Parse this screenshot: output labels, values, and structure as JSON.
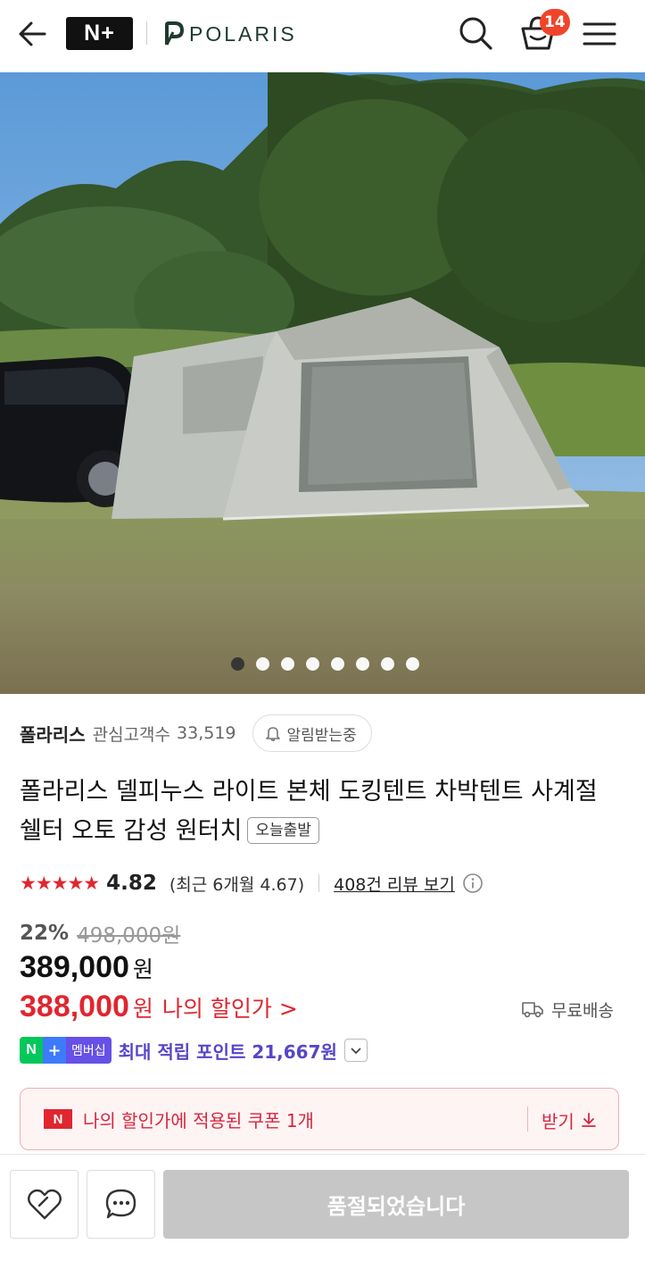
{
  "header": {
    "brand_badge": "N+",
    "brand_name": "POLARIS",
    "cart_count": "14"
  },
  "gallery": {
    "total_images": 8,
    "active_index": 0
  },
  "store": {
    "name": "폴라리스",
    "fav_label": "관심고객수",
    "fav_count": "33,519",
    "alarm_label": "알림받는중"
  },
  "product": {
    "title": "폴라리스 델피누스 라이트 본체 도킹텐트 차박텐트 사계절 쉘터 오토 감성 원터치",
    "tag": "오늘출발",
    "stars": "★★★★★",
    "rating": "4.82",
    "recent_rating": "(최근 6개월 4.67)",
    "review_link": "408건 리뷰 보기",
    "discount": "22%",
    "original_price": "498,000원",
    "price": "389,000",
    "price_unit": "원",
    "my_price": "388,000",
    "my_price_unit": "원",
    "my_price_label": "나의 할인가",
    "my_price_chevron": ">",
    "shipping": "무료배송"
  },
  "points": {
    "badge_n": "N",
    "badge_plus": "+",
    "badge_member": "멤버십",
    "text": "최대 적립 포인트 21,667원"
  },
  "coupon": {
    "badge": "N",
    "text": "나의 할인가에 적용된 쿠폰 1개",
    "get_label": "받기"
  },
  "bottom": {
    "soldout_label": "품절되었습니다"
  },
  "colors": {
    "accent_red": "#e0262f",
    "naver_green": "#03c75a",
    "membership_purple": "#6650e6"
  }
}
